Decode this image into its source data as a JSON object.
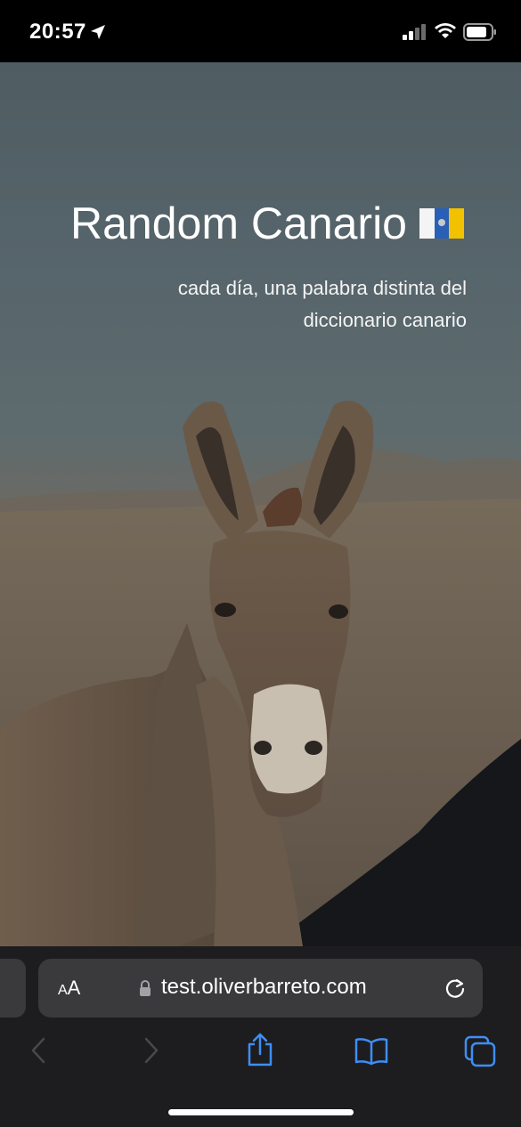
{
  "status_bar": {
    "time": "20:57",
    "icons": [
      "location-arrow-icon",
      "cellular-signal-icon",
      "wifi-icon",
      "battery-icon"
    ]
  },
  "page": {
    "title": "Random Canario",
    "flag_icon": "canary-islands-flag-icon",
    "subtitle": "cada día, una palabra distinta del diccionario canario",
    "background_image": "donkey-photo"
  },
  "safari": {
    "aa_label_small": "A",
    "aa_label_large": "A",
    "url": "test.oliverbarreto.com",
    "toolbar_icons": [
      "back-icon",
      "forward-icon",
      "share-icon",
      "bookmarks-icon",
      "tabs-icon"
    ]
  },
  "colors": {
    "accent": "#3e8ef7",
    "toolbar_bg": "#1d1d1f",
    "url_bar_bg": "#3a3a3c"
  }
}
